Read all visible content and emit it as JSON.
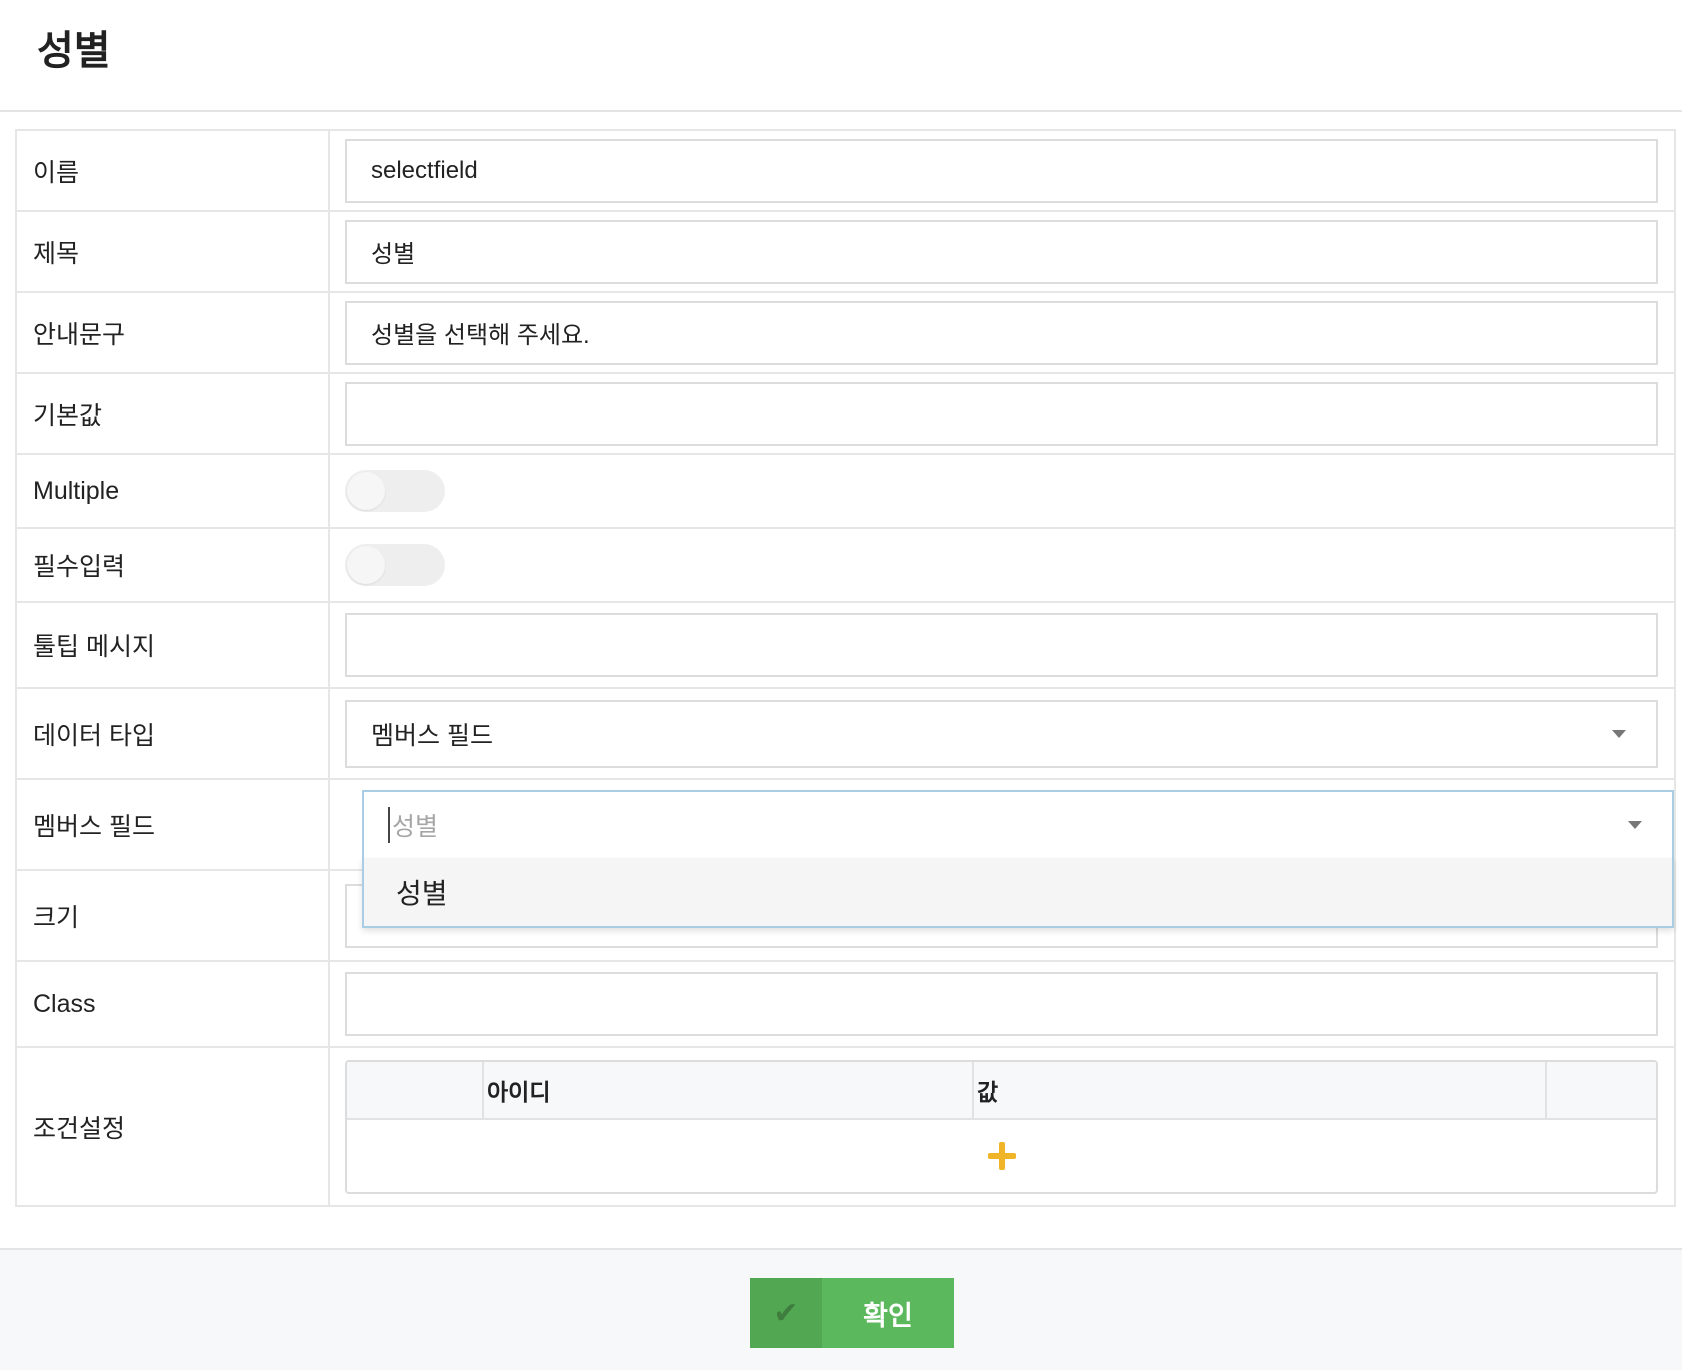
{
  "page": {
    "title": "성별"
  },
  "form": {
    "name": {
      "label": "이름",
      "value": "selectfield"
    },
    "title_field": {
      "label": "제목",
      "value": "성별"
    },
    "guide_text": {
      "label": "안내문구",
      "value": "성별을 선택해 주세요."
    },
    "default_value": {
      "label": "기본값",
      "value": ""
    },
    "multiple": {
      "label": "Multiple",
      "enabled": false
    },
    "required": {
      "label": "필수입력",
      "enabled": false
    },
    "tooltip": {
      "label": "툴팁 메시지",
      "value": ""
    },
    "data_type": {
      "label": "데이터 타입",
      "selected": "멤버스 필드"
    },
    "members_field": {
      "label": "멤버스 필드",
      "placeholder": "성별",
      "options": [
        "성별"
      ]
    },
    "size": {
      "label": "크기",
      "value": ""
    },
    "class_field": {
      "label": "Class",
      "value": ""
    },
    "conditions": {
      "label": "조건설정",
      "columns": [
        "아이디",
        "값"
      ]
    }
  },
  "icons": {
    "add": "plus-icon",
    "confirm": "check-icon",
    "dropdown": "chevron-down-icon"
  },
  "colors": {
    "accent_plus": "#f0b429",
    "confirm_green": "#5cb85c",
    "focus_border": "#a9cde3"
  },
  "footer": {
    "confirm_label": "확인"
  }
}
